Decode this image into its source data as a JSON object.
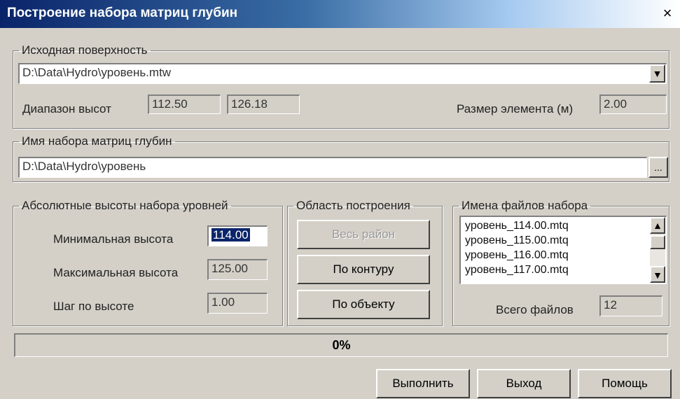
{
  "window": {
    "title": "Построение набора матриц глубин",
    "close": "×"
  },
  "source": {
    "legend": "Исходная поверхность",
    "file": "D:\\Data\\Hydro\\уровень.mtw",
    "range_label": "Диапазон высот",
    "range_min": "112.50",
    "range_max": "126.18",
    "element_size_label": "Размер элемента (м)",
    "element_size": "2.00"
  },
  "set_name": {
    "legend": "Имя набора матриц глубин",
    "value": "D:\\Data\\Hydro\\уровень",
    "browse": "..."
  },
  "levels": {
    "legend": "Абсолютные высоты набора уровней",
    "min_label": "Минимальная высота",
    "min_value": "114.00",
    "max_label": "Максимальная высота",
    "max_value": "125.00",
    "step_label": "Шаг по высоте",
    "step_value": "1.00"
  },
  "area": {
    "legend": "Область построения",
    "whole": "Весь район",
    "contour": "По контуру",
    "object": "По объекту"
  },
  "files": {
    "legend": "Имена файлов набора",
    "items": [
      "уровень_114.00.mtq",
      "уровень_115.00.mtq",
      "уровень_116.00.mtq",
      "уровень_117.00.mtq"
    ],
    "total_label": "Всего файлов",
    "total": "12"
  },
  "progress": {
    "text": "0%",
    "value": 0
  },
  "buttons": {
    "run": "Выполнить",
    "exit": "Выход",
    "help": "Помощь"
  },
  "icons": {
    "dropdown": "triangle-down",
    "scroll_up": "triangle-up",
    "scroll_down": "triangle-down"
  }
}
